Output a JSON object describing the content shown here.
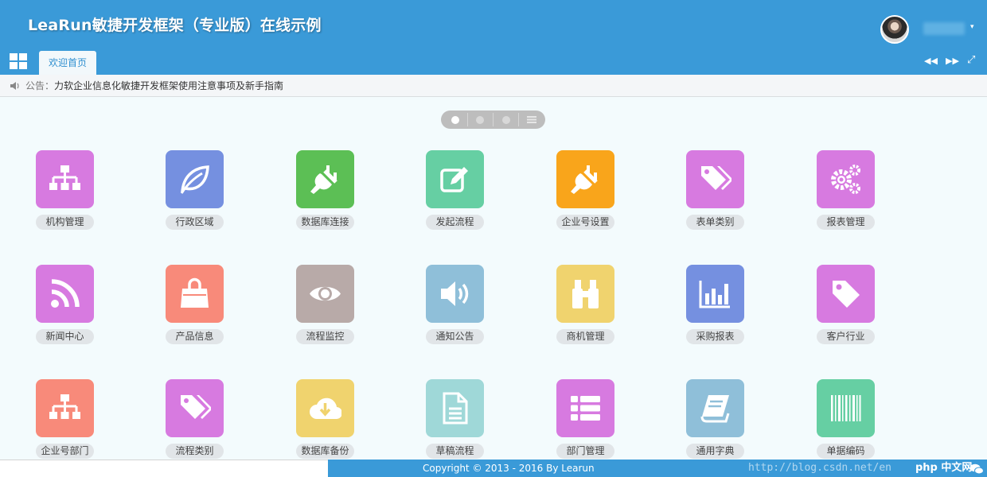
{
  "header": {
    "title": "LeaRun敏捷开发框架（专业版）在线示例",
    "user_caret": "▾"
  },
  "tabs": [
    {
      "label": "欢迎首页",
      "active": true
    }
  ],
  "tab_controls": {
    "prev": "◀◀",
    "next": "▶▶",
    "fullscreen": "⤢"
  },
  "notice": {
    "label": "公告：",
    "message": "力软企业信息化敏捷开发框架使用注意事项及新手指南"
  },
  "pager": {
    "pages": 3,
    "current": 1
  },
  "tiles": [
    {
      "label": "机构管理",
      "color": "#d77ae0",
      "icon": "sitemap-icon"
    },
    {
      "label": "行政区域",
      "color": "#7590e0",
      "icon": "leaf-icon"
    },
    {
      "label": "数据库连接",
      "color": "#5cbf55",
      "icon": "plug-icon"
    },
    {
      "label": "发起流程",
      "color": "#66cfa3",
      "icon": "edit-icon"
    },
    {
      "label": "企业号设置",
      "color": "#f9a51b",
      "icon": "plug-icon"
    },
    {
      "label": "表单类别",
      "color": "#d77ae0",
      "icon": "tags-icon"
    },
    {
      "label": "报表管理",
      "color": "#d77ae0",
      "icon": "gears-icon"
    },
    {
      "label": "新闻中心",
      "color": "#d77ae0",
      "icon": "rss-icon"
    },
    {
      "label": "产品信息",
      "color": "#f88a7a",
      "icon": "shopping-bag-icon"
    },
    {
      "label": "流程监控",
      "color": "#b8aaa8",
      "icon": "eye-icon"
    },
    {
      "label": "通知公告",
      "color": "#8fbfd9",
      "icon": "volume-icon"
    },
    {
      "label": "商机管理",
      "color": "#f0d36e",
      "icon": "binoculars-icon"
    },
    {
      "label": "采购报表",
      "color": "#7590e0",
      "icon": "bar-chart-icon"
    },
    {
      "label": "客户行业",
      "color": "#d77ae0",
      "icon": "tag-icon"
    },
    {
      "label": "企业号部门",
      "color": "#f88a7a",
      "icon": "sitemap-icon"
    },
    {
      "label": "流程类别",
      "color": "#d77ae0",
      "icon": "tags-icon"
    },
    {
      "label": "数据库备份",
      "color": "#f0d36e",
      "icon": "cloud-download-icon"
    },
    {
      "label": "草稿流程",
      "color": "#9fd8d8",
      "icon": "file-text-icon"
    },
    {
      "label": "部门管理",
      "color": "#d77ae0",
      "icon": "list-icon"
    },
    {
      "label": "通用字典",
      "color": "#8fbfd9",
      "icon": "book-icon"
    },
    {
      "label": "单据编码",
      "color": "#66cfa3",
      "icon": "barcode-icon"
    }
  ],
  "footer": {
    "copyright": "Copyright © 2013 - 2016 By Learun",
    "watermark": "http://blog.csdn.net/en",
    "watermark_brand": "php 中文网"
  }
}
